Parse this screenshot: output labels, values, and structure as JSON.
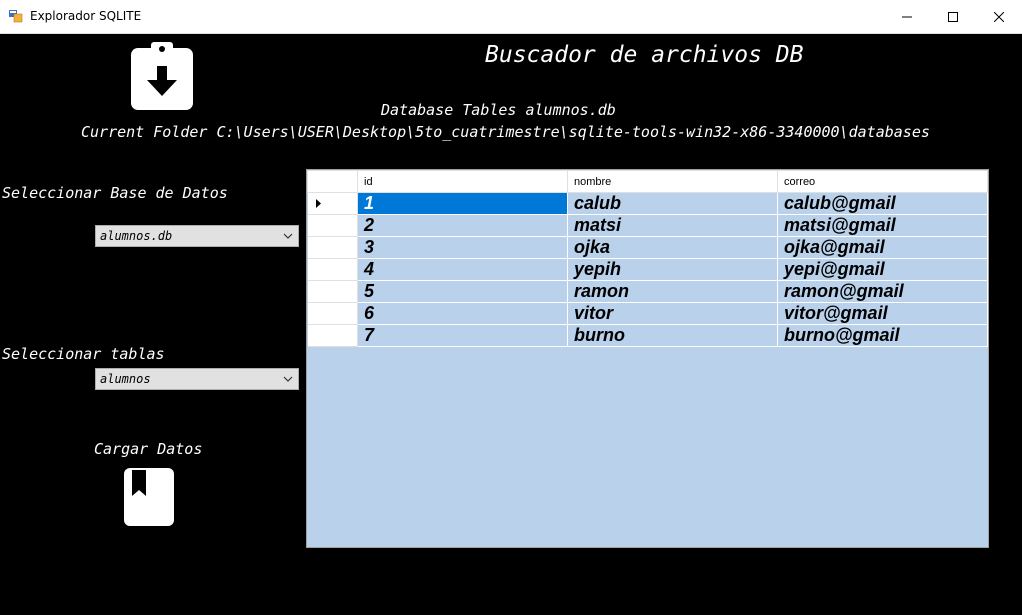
{
  "window": {
    "title": "Explorador SQLITE"
  },
  "header": {
    "main_title": "Buscador de archivos DB",
    "database_tables": "Database Tables alumnos.db",
    "current_folder": "Current Folder C:\\Users\\USER\\Desktop\\5to_cuatrimestre\\sqlite-tools-win32-x86-3340000\\databases"
  },
  "left_panel": {
    "select_db_label": "Seleccionar Base de Datos",
    "select_db_value": "alumnos.db",
    "select_table_label": "Seleccionar tablas",
    "select_table_value": "alumnos",
    "load_label": "Cargar Datos"
  },
  "grid": {
    "columns": [
      "id",
      "nombre",
      "correo"
    ],
    "rows": [
      [
        "1",
        "calub",
        "calub@gmail"
      ],
      [
        "2",
        "matsi",
        "matsi@gmail"
      ],
      [
        "3",
        "ojka",
        "ojka@gmail"
      ],
      [
        "4",
        "yepih",
        "yepi@gmail"
      ],
      [
        "5",
        "ramon",
        "ramon@gmail"
      ],
      [
        "6",
        "vitor",
        "vitor@gmail"
      ],
      [
        "7",
        "burno",
        "burno@gmail"
      ]
    ]
  },
  "icons": {
    "app": "database-explorer-icon",
    "download": "clipboard-download-icon",
    "load": "bookmark-icon"
  },
  "colors": {
    "background": "#000000",
    "grid_background": "#b9d1ea",
    "selection": "#0078d7"
  }
}
